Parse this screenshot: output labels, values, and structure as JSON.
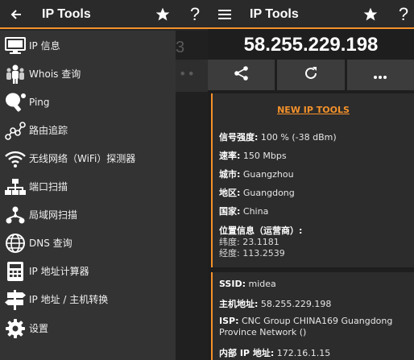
{
  "left_toolbar": {
    "title": "IP Tools",
    "back_icon": "arrow-left-icon",
    "star_icon": "star-icon",
    "help_icon": "help-icon"
  },
  "drawer": {
    "items": [
      {
        "label": "IP 信息",
        "icon": "monitor-icon"
      },
      {
        "label": "Whois 查询",
        "icon": "people-icon"
      },
      {
        "label": "Ping",
        "icon": "ping-pong-icon"
      },
      {
        "label": "路由追踪",
        "icon": "route-icon"
      },
      {
        "label": "无线网络（WiFi）探测器",
        "icon": "wifi-icon"
      },
      {
        "label": "端口扫描",
        "icon": "network-icon"
      },
      {
        "label": "局域网扫描",
        "icon": "lan-icon"
      },
      {
        "label": "DNS 查询",
        "icon": "globe-icon"
      },
      {
        "label": "IP 地址计算器",
        "icon": "calculator-icon"
      },
      {
        "label": "IP 地址 / 主机转换",
        "icon": "signpost-icon"
      },
      {
        "label": "设置",
        "icon": "gear-icon"
      }
    ]
  },
  "behind": {
    "ghost_char": "3",
    "ghost_dots": "••"
  },
  "right_toolbar": {
    "title": "IP Tools",
    "menu_icon": "hamburger-icon",
    "star_icon": "star-icon",
    "help_icon": "help-icon"
  },
  "ip_address": "58.255.229.198",
  "actions": [
    {
      "icon": "share-icon"
    },
    {
      "icon": "refresh-icon"
    },
    {
      "icon": "more-icon"
    }
  ],
  "card1": {
    "title": "NEW IP TOOLS",
    "signal_label": "信号强度:",
    "signal_value": "100 % (-38 dBm)",
    "speed_label": "速率:",
    "speed_value": "150 Mbps",
    "city_label": "城市:",
    "city_value": "Guangzhou",
    "region_label": "地区:",
    "region_value": "Guangdong",
    "country_label": "国家:",
    "country_value": "China",
    "location_label": "位置信息（运营商）:",
    "lat_label": "纬度:",
    "lat_value": "23.1181",
    "lon_label": "经度:",
    "lon_value": "113.2539"
  },
  "card2": {
    "ssid_label": "SSID:",
    "ssid_value": "midea",
    "host_label": "主机地址:",
    "host_value": "58.255.229.198",
    "isp_label": "ISP:",
    "isp_value": "CNC Group CHINA169 Guangdong Province Network ()",
    "internal_label": "内部 IP 地址:",
    "internal_value": "172.16.1.15"
  },
  "colors": {
    "accent": "#f5922a",
    "drawer_bg": "#333333",
    "card_bg": "#2c2c2c"
  }
}
